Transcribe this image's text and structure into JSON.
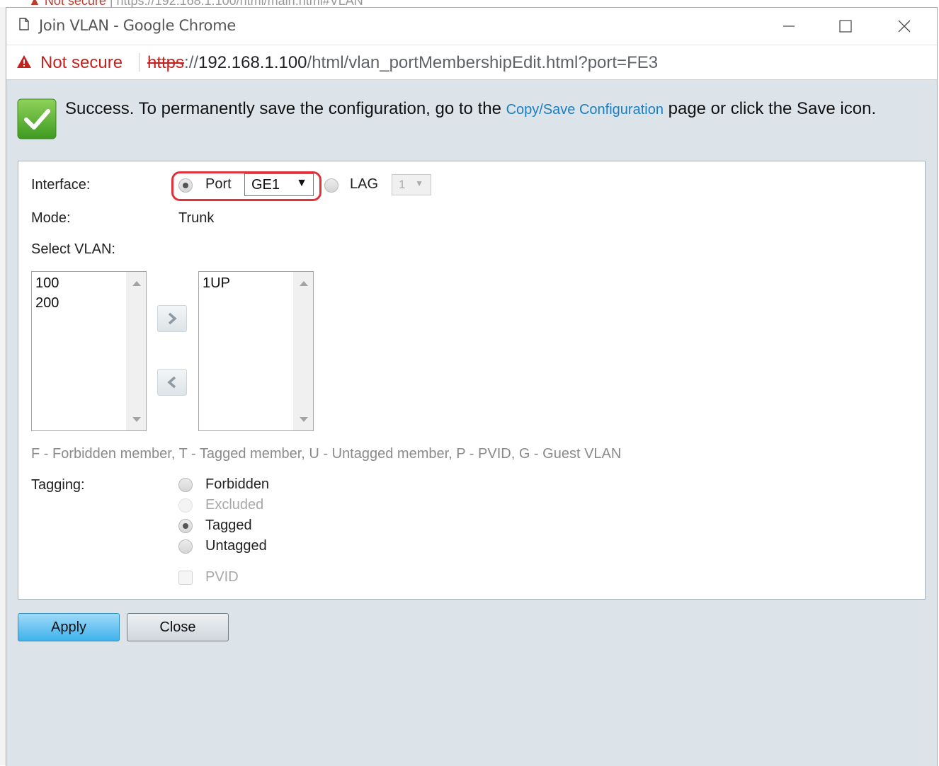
{
  "window": {
    "title": "Join VLAN - Google Chrome",
    "controls": [
      "minimize",
      "maximize",
      "close"
    ]
  },
  "address_bar": {
    "security_label": "Not secure",
    "url_scheme": "https",
    "url_host": "192.168.1.100",
    "url_rest": "/html/vlan_portMembershipEdit.html?port=FE3"
  },
  "banner": {
    "text_before": "Success. To permanently save the configuration, go to the ",
    "link": "Copy/Save Configuration",
    "text_after": " page or click the Save icon."
  },
  "form": {
    "interface_label": "Interface:",
    "port_label": "Port",
    "port_value": "GE1",
    "lag_label": "LAG",
    "lag_value": "1",
    "mode_label": "Mode:",
    "mode_value": "Trunk",
    "select_vlan_label": "Select VLAN:",
    "available_vlans": [
      "100",
      "200"
    ],
    "member_vlans": [
      "1UP"
    ],
    "legend": "F - Forbidden member, T - Tagged member, U - Untagged member, P - PVID, G - Guest VLAN",
    "tagging_label": "Tagging:",
    "tagging_options": [
      {
        "label": "Forbidden",
        "selected": false,
        "disabled": false
      },
      {
        "label": "Excluded",
        "selected": false,
        "disabled": true
      },
      {
        "label": "Tagged",
        "selected": true,
        "disabled": false
      },
      {
        "label": "Untagged",
        "selected": false,
        "disabled": false
      }
    ],
    "pvid_label": "PVID",
    "pvid_checked": false
  },
  "buttons": {
    "apply": "Apply",
    "close": "Close"
  },
  "colors": {
    "accent_blue": "#3eb2ec",
    "warning_red": "#c5221f",
    "highlight_red": "#e0313b",
    "success_green": "#56b132",
    "dialog_bg": "#dce4ea"
  }
}
